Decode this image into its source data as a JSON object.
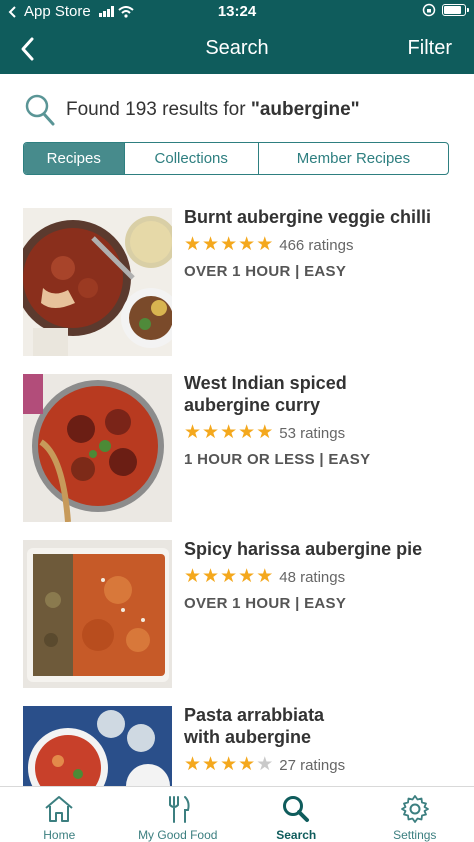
{
  "status_bar": {
    "carrier": "App Store",
    "time": "13:24",
    "icons": [
      "back-arrow-icon",
      "signal-icon",
      "wifi-icon",
      "rotation-lock-icon",
      "battery-icon"
    ]
  },
  "nav": {
    "title": "Search",
    "filter_label": "Filter",
    "back_icon": "back-chevron-icon"
  },
  "results": {
    "prefix": "Found 193 results for ",
    "query": "\"aubergine\""
  },
  "segments": {
    "tabs": [
      {
        "label": "Recipes",
        "active": true
      },
      {
        "label": "Collections",
        "active": false
      },
      {
        "label": "Member Recipes",
        "active": false
      }
    ]
  },
  "recipes": [
    {
      "title_line1": "Burnt aubergine veggie chilli",
      "title_line2": "",
      "stars": 5,
      "ratings": "466 ratings",
      "time": "OVER 1 HOUR",
      "difficulty": "EASY"
    },
    {
      "title_line1": "West Indian spiced",
      "title_line2": "aubergine curry",
      "stars": 5,
      "ratings": "53 ratings",
      "time": "1 HOUR OR LESS",
      "difficulty": "EASY"
    },
    {
      "title_line1": "Spicy harissa aubergine pie",
      "title_line2": "",
      "stars": 5,
      "ratings": "48 ratings",
      "time": "OVER 1 HOUR",
      "difficulty": "EASY"
    },
    {
      "title_line1": "Pasta arrabbiata",
      "title_line2": "with aubergine",
      "stars": 4,
      "ratings": "27 ratings",
      "time": "",
      "difficulty": ""
    }
  ],
  "meta_separator": "|",
  "tab_bar": {
    "items": [
      {
        "label": "Home",
        "icon": "home-icon",
        "active": false
      },
      {
        "label": "My Good Food",
        "icon": "fork-knife-icon",
        "active": false
      },
      {
        "label": "Search",
        "icon": "search-icon",
        "active": true
      },
      {
        "label": "Settings",
        "icon": "gear-icon",
        "active": false
      }
    ]
  },
  "colors": {
    "header": "#0f5c5c",
    "accent": "#2e7f80",
    "active_segment": "#478b8c",
    "star": "#f4a81d"
  }
}
